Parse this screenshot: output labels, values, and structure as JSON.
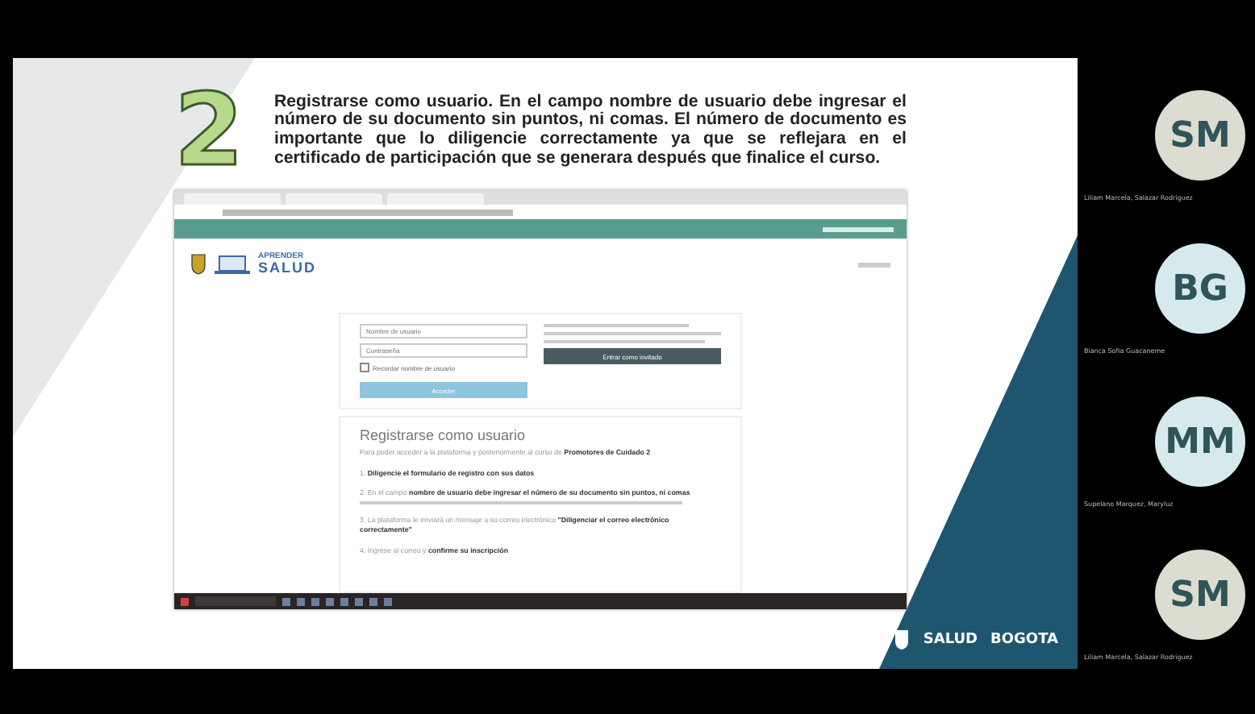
{
  "slide": {
    "step_number": "2",
    "instruction": "Registrarse como usuario. En el campo nombre de usuario debe ingresar el número de su documento sin puntos, ni comas. El número de documento es importante que lo diligencie correctamente ya que se reflejara en el certificado de participación que se generara después que finalice el curso.",
    "browser": {
      "site_logo": {
        "line1": "APRENDER",
        "line2": "SALUD"
      },
      "login": {
        "username_placeholder": "Nombre de usuario",
        "password_placeholder": "Contraseña",
        "remember_label": "Recordar nombre de usuario",
        "remember_checked": false,
        "login_button": "Acceder",
        "guest_button": "Entrar como invitado"
      },
      "register": {
        "title": "Registrarse como usuario",
        "intro": "Para poder acceder a la plataforma y posteriormente al curso de **Promotores de Cuidado 2**",
        "steps": [
          {
            "text": "1. **Diligencie el formulario de registro con sus datos**"
          },
          {
            "text": "2. En el campo **nombre de usuario debe ingresar el número de su documento sin puntos, ni comas**"
          },
          {
            "text": "3. La plataforma le enviará un mensaje a su correo electrónico **\"Diligenciar el correo electrónico correctamente\"**"
          },
          {
            "text": "4. Ingrese al correo y **confirme su inscripción**"
          }
        ]
      }
    },
    "footer_logos": [
      {
        "text": "SALUD"
      },
      {
        "text": "BOGOTA"
      }
    ]
  },
  "participants": [
    {
      "initials": "SM",
      "name": "Liliam Marcela, Salazar Rodriguez",
      "color": "#dcdcd0"
    },
    {
      "initials": "BG",
      "name": "Bianca Sofia Guacaneme",
      "color": "#d6eaee"
    },
    {
      "initials": "MM",
      "name": "Supelano Marquez, Maryluz",
      "color": "#d6eaee"
    },
    {
      "initials": "SM",
      "name": "Liliam Marcela, Salazar Rodriguez",
      "color": "#dcdcd0"
    }
  ]
}
